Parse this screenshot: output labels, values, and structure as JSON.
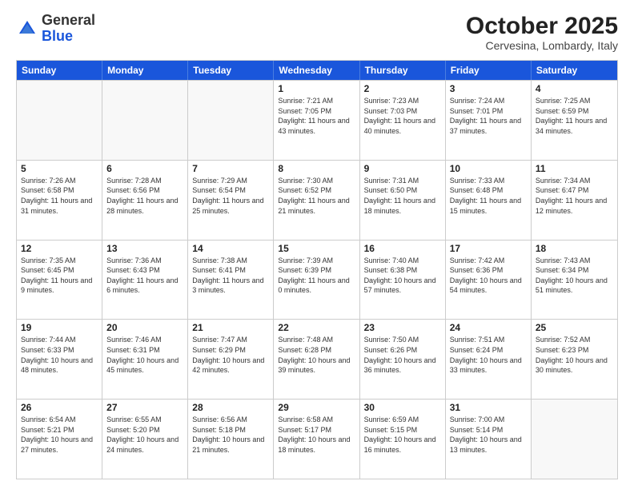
{
  "logo": {
    "general": "General",
    "blue": "Blue"
  },
  "header": {
    "month": "October 2025",
    "location": "Cervesina, Lombardy, Italy"
  },
  "weekdays": [
    "Sunday",
    "Monday",
    "Tuesday",
    "Wednesday",
    "Thursday",
    "Friday",
    "Saturday"
  ],
  "rows": [
    [
      {
        "day": "",
        "sunrise": "",
        "sunset": "",
        "daylight": "",
        "empty": true
      },
      {
        "day": "",
        "sunrise": "",
        "sunset": "",
        "daylight": "",
        "empty": true
      },
      {
        "day": "",
        "sunrise": "",
        "sunset": "",
        "daylight": "",
        "empty": true
      },
      {
        "day": "1",
        "sunrise": "Sunrise: 7:21 AM",
        "sunset": "Sunset: 7:05 PM",
        "daylight": "Daylight: 11 hours and 43 minutes."
      },
      {
        "day": "2",
        "sunrise": "Sunrise: 7:23 AM",
        "sunset": "Sunset: 7:03 PM",
        "daylight": "Daylight: 11 hours and 40 minutes."
      },
      {
        "day": "3",
        "sunrise": "Sunrise: 7:24 AM",
        "sunset": "Sunset: 7:01 PM",
        "daylight": "Daylight: 11 hours and 37 minutes."
      },
      {
        "day": "4",
        "sunrise": "Sunrise: 7:25 AM",
        "sunset": "Sunset: 6:59 PM",
        "daylight": "Daylight: 11 hours and 34 minutes."
      }
    ],
    [
      {
        "day": "5",
        "sunrise": "Sunrise: 7:26 AM",
        "sunset": "Sunset: 6:58 PM",
        "daylight": "Daylight: 11 hours and 31 minutes."
      },
      {
        "day": "6",
        "sunrise": "Sunrise: 7:28 AM",
        "sunset": "Sunset: 6:56 PM",
        "daylight": "Daylight: 11 hours and 28 minutes."
      },
      {
        "day": "7",
        "sunrise": "Sunrise: 7:29 AM",
        "sunset": "Sunset: 6:54 PM",
        "daylight": "Daylight: 11 hours and 25 minutes."
      },
      {
        "day": "8",
        "sunrise": "Sunrise: 7:30 AM",
        "sunset": "Sunset: 6:52 PM",
        "daylight": "Daylight: 11 hours and 21 minutes."
      },
      {
        "day": "9",
        "sunrise": "Sunrise: 7:31 AM",
        "sunset": "Sunset: 6:50 PM",
        "daylight": "Daylight: 11 hours and 18 minutes."
      },
      {
        "day": "10",
        "sunrise": "Sunrise: 7:33 AM",
        "sunset": "Sunset: 6:48 PM",
        "daylight": "Daylight: 11 hours and 15 minutes."
      },
      {
        "day": "11",
        "sunrise": "Sunrise: 7:34 AM",
        "sunset": "Sunset: 6:47 PM",
        "daylight": "Daylight: 11 hours and 12 minutes."
      }
    ],
    [
      {
        "day": "12",
        "sunrise": "Sunrise: 7:35 AM",
        "sunset": "Sunset: 6:45 PM",
        "daylight": "Daylight: 11 hours and 9 minutes."
      },
      {
        "day": "13",
        "sunrise": "Sunrise: 7:36 AM",
        "sunset": "Sunset: 6:43 PM",
        "daylight": "Daylight: 11 hours and 6 minutes."
      },
      {
        "day": "14",
        "sunrise": "Sunrise: 7:38 AM",
        "sunset": "Sunset: 6:41 PM",
        "daylight": "Daylight: 11 hours and 3 minutes."
      },
      {
        "day": "15",
        "sunrise": "Sunrise: 7:39 AM",
        "sunset": "Sunset: 6:39 PM",
        "daylight": "Daylight: 11 hours and 0 minutes."
      },
      {
        "day": "16",
        "sunrise": "Sunrise: 7:40 AM",
        "sunset": "Sunset: 6:38 PM",
        "daylight": "Daylight: 10 hours and 57 minutes."
      },
      {
        "day": "17",
        "sunrise": "Sunrise: 7:42 AM",
        "sunset": "Sunset: 6:36 PM",
        "daylight": "Daylight: 10 hours and 54 minutes."
      },
      {
        "day": "18",
        "sunrise": "Sunrise: 7:43 AM",
        "sunset": "Sunset: 6:34 PM",
        "daylight": "Daylight: 10 hours and 51 minutes."
      }
    ],
    [
      {
        "day": "19",
        "sunrise": "Sunrise: 7:44 AM",
        "sunset": "Sunset: 6:33 PM",
        "daylight": "Daylight: 10 hours and 48 minutes."
      },
      {
        "day": "20",
        "sunrise": "Sunrise: 7:46 AM",
        "sunset": "Sunset: 6:31 PM",
        "daylight": "Daylight: 10 hours and 45 minutes."
      },
      {
        "day": "21",
        "sunrise": "Sunrise: 7:47 AM",
        "sunset": "Sunset: 6:29 PM",
        "daylight": "Daylight: 10 hours and 42 minutes."
      },
      {
        "day": "22",
        "sunrise": "Sunrise: 7:48 AM",
        "sunset": "Sunset: 6:28 PM",
        "daylight": "Daylight: 10 hours and 39 minutes."
      },
      {
        "day": "23",
        "sunrise": "Sunrise: 7:50 AM",
        "sunset": "Sunset: 6:26 PM",
        "daylight": "Daylight: 10 hours and 36 minutes."
      },
      {
        "day": "24",
        "sunrise": "Sunrise: 7:51 AM",
        "sunset": "Sunset: 6:24 PM",
        "daylight": "Daylight: 10 hours and 33 minutes."
      },
      {
        "day": "25",
        "sunrise": "Sunrise: 7:52 AM",
        "sunset": "Sunset: 6:23 PM",
        "daylight": "Daylight: 10 hours and 30 minutes."
      }
    ],
    [
      {
        "day": "26",
        "sunrise": "Sunrise: 6:54 AM",
        "sunset": "Sunset: 5:21 PM",
        "daylight": "Daylight: 10 hours and 27 minutes."
      },
      {
        "day": "27",
        "sunrise": "Sunrise: 6:55 AM",
        "sunset": "Sunset: 5:20 PM",
        "daylight": "Daylight: 10 hours and 24 minutes."
      },
      {
        "day": "28",
        "sunrise": "Sunrise: 6:56 AM",
        "sunset": "Sunset: 5:18 PM",
        "daylight": "Daylight: 10 hours and 21 minutes."
      },
      {
        "day": "29",
        "sunrise": "Sunrise: 6:58 AM",
        "sunset": "Sunset: 5:17 PM",
        "daylight": "Daylight: 10 hours and 18 minutes."
      },
      {
        "day": "30",
        "sunrise": "Sunrise: 6:59 AM",
        "sunset": "Sunset: 5:15 PM",
        "daylight": "Daylight: 10 hours and 16 minutes."
      },
      {
        "day": "31",
        "sunrise": "Sunrise: 7:00 AM",
        "sunset": "Sunset: 5:14 PM",
        "daylight": "Daylight: 10 hours and 13 minutes."
      },
      {
        "day": "",
        "sunrise": "",
        "sunset": "",
        "daylight": "",
        "empty": true
      }
    ]
  ]
}
